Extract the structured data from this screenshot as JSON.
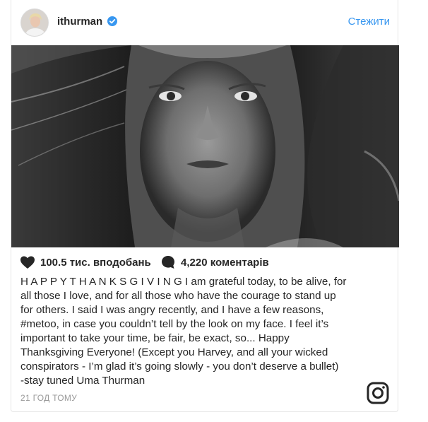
{
  "post": {
    "username": "ithurman",
    "verified": true,
    "follow_label": "Стежити",
    "likes_text": "100.5 тис. вподобань",
    "comments_text": "4,220 коментарів",
    "caption": "H A P P Y T H A N K S G I V I N G I am grateful today, to be alive, for\nall those I love, and for all those who have the courage to stand up\nfor others. I said I was angry recently, and I have a few reasons,\n#metoo, in case you couldn’t tell by the look on my face. I feel it’s\nimportant to take your time, be fair, be exact, so... Happy\nThanksgiving Everyone! (Except you Harvey, and all your wicked\nconspirators - I’m glad it’s going slowly - you don’t deserve a bullet)\n-stay tuned Uma Thurman",
    "timestamp": "21 ГОД ТОМУ"
  },
  "icons": {
    "avatar": "profile-photo",
    "verified": "verified-badge-icon",
    "like": "heart-icon",
    "comment": "comment-bubble-icon",
    "brand": "instagram-glyph-icon"
  },
  "colors": {
    "accent": "#3897f0",
    "text": "#262626",
    "muted": "#999999",
    "border": "#e6e6e6"
  }
}
